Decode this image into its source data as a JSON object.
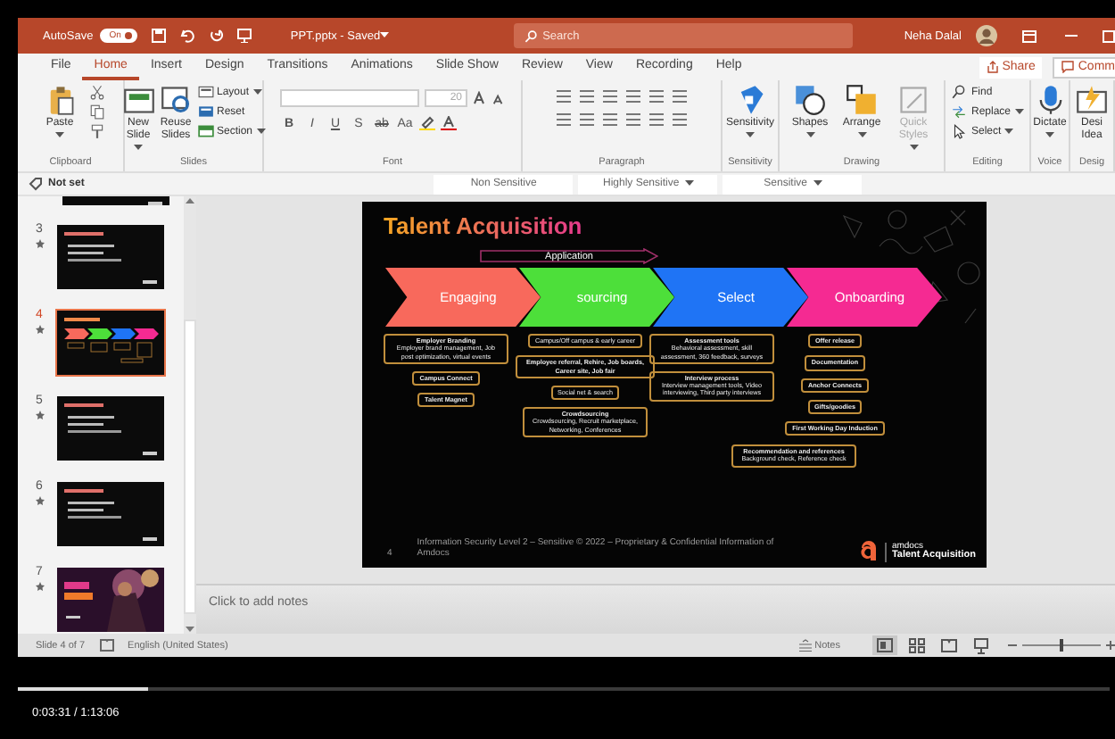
{
  "window": {
    "autosave_label": "AutoSave",
    "autosave_state": "On",
    "autosave_on": true,
    "title": "PPT.pptx - Saved",
    "search_placeholder": "Search",
    "user": "Neha Dalal"
  },
  "menu_tabs": [
    {
      "label": "File",
      "selected": false
    },
    {
      "label": "Home",
      "selected": true
    },
    {
      "label": "Insert",
      "selected": false
    },
    {
      "label": "Design",
      "selected": false
    },
    {
      "label": "Transitions",
      "selected": false
    },
    {
      "label": "Animations",
      "selected": false
    },
    {
      "label": "Slide Show",
      "selected": false
    },
    {
      "label": "Review",
      "selected": false
    },
    {
      "label": "View",
      "selected": false
    },
    {
      "label": "Recording",
      "selected": false
    },
    {
      "label": "Help",
      "selected": false
    }
  ],
  "share_button": "Share",
  "comments_button": "Comm",
  "ribbon": {
    "groups": [
      {
        "label": "Clipboard",
        "kind": "buttons",
        "items": [
          {
            "kind": "large",
            "label": "Paste",
            "dropdown": true
          },
          {
            "kind": "icon"
          },
          {
            "kind": "icon"
          },
          {
            "kind": "icon"
          }
        ]
      },
      {
        "label": "Slides",
        "kind": "buttons",
        "items": [
          {
            "kind": "large",
            "label": "New Slide",
            "dropdown": true
          },
          {
            "kind": "large",
            "label": "Reuse Slides",
            "dropdown": false
          },
          {
            "kind": "small",
            "label": "Layout",
            "dropdown": true
          },
          {
            "kind": "small",
            "label": "Reset",
            "dropdown": false
          },
          {
            "kind": "small",
            "label": "Section",
            "dropdown": true
          }
        ]
      },
      {
        "label": "Font",
        "kind": "font",
        "size": "20",
        "glyphs": [
          {
            "text": "B",
            "kind": "bold"
          },
          {
            "text": "I",
            "kind": "italic"
          },
          {
            "text": "U",
            "kind": "underline"
          },
          {
            "text": "S",
            "kind": "plain"
          },
          {
            "text": "ab",
            "kind": "strike"
          },
          {
            "text": "Aa",
            "kind": "plain"
          }
        ]
      },
      {
        "label": "Paragraph",
        "kind": "paragraph"
      },
      {
        "label": "Sensitivity",
        "kind": "buttons",
        "items": [
          {
            "kind": "large",
            "label": "Sensitivity",
            "dropdown": true
          }
        ]
      },
      {
        "label": "Drawing",
        "kind": "buttons",
        "items": [
          {
            "kind": "large",
            "label": "Shapes",
            "dropdown": true,
            "disabled": false
          },
          {
            "kind": "large",
            "label": "Arrange",
            "dropdown": true,
            "disabled": false
          },
          {
            "kind": "large",
            "label": "Quick Styles",
            "dropdown": true,
            "disabled": true
          }
        ]
      },
      {
        "label": "Editing",
        "kind": "buttons",
        "items": [
          {
            "kind": "small",
            "label": "Find",
            "dropdown": false
          },
          {
            "kind": "small",
            "label": "Replace",
            "dropdown": true
          },
          {
            "kind": "small",
            "label": "Select",
            "dropdown": true
          }
        ]
      },
      {
        "label": "Voice",
        "kind": "buttons",
        "items": [
          {
            "kind": "large",
            "label": "Dictate",
            "dropdown": true
          }
        ]
      },
      {
        "label": "Desig",
        "kind": "buttons",
        "items": [
          {
            "kind": "large",
            "label": "Desi Idea",
            "dropdown": false
          }
        ]
      }
    ]
  },
  "sensitivity_bar": {
    "status": "Not set",
    "labels": [
      {
        "label": "Non Sensitive",
        "dropdown": false
      },
      {
        "label": "Highly Sensitive",
        "dropdown": true
      },
      {
        "label": "Sensitive",
        "dropdown": true
      }
    ]
  },
  "slides_panel": {
    "slides": [
      {
        "number": "3",
        "selected": false,
        "kind": "text"
      },
      {
        "number": "4",
        "selected": true,
        "kind": "process"
      },
      {
        "number": "5",
        "selected": false,
        "kind": "text"
      },
      {
        "number": "6",
        "selected": false,
        "kind": "text"
      },
      {
        "number": "7",
        "selected": false,
        "kind": "photo"
      }
    ]
  },
  "slide": {
    "title": "Talent Acquisition",
    "flow_arrow": "Application",
    "stages": [
      {
        "label": "Engaging",
        "color": "#f8695c",
        "boxes": [
          {
            "title": "Employer Branding",
            "text": "Employer brand management, Job post optimization, virtual events"
          },
          {
            "title": "Campus Connect"
          },
          {
            "title": "Talent Magnet"
          }
        ]
      },
      {
        "label": "sourcing",
        "color": "#4ddf3a",
        "boxes": [
          {
            "text": "Campus/Off campus & early career"
          },
          {
            "title": "Employee referral, Rehire, Job boards, Career site, Job fair"
          },
          {
            "text": "Social net & search"
          },
          {
            "title": "Crowdsourcing",
            "text": "Crowdsourcing, Recruit marketplace, Networking, Conferences"
          }
        ]
      },
      {
        "label": "Select",
        "color": "#1f74f5",
        "boxes": [
          {
            "title": "Assessment tools",
            "text": "Behavioral assessment, skill assessment, 360 feedback, surveys"
          },
          {
            "title": "Interview process",
            "text": "Interview management tools, Video interviewing, Third party interviews"
          }
        ]
      },
      {
        "label": "Onboarding",
        "color": "#f52a92",
        "boxes": [
          {
            "title": "Offer release"
          },
          {
            "title": "Documentation"
          },
          {
            "title": "Anchor Connects"
          },
          {
            "title": "Gifts/goodies"
          },
          {
            "title": "First Working Day Induction"
          }
        ]
      }
    ],
    "extra_box": {
      "title": "Recommendation and references",
      "text": "Background check, Reference check"
    },
    "page_number": "4",
    "footer": "Information Security Level 2 – Sensitive © 2022 – Proprietary & Confidential Information of Amdocs",
    "logo_brand": "amdocs",
    "logo_caption": "Talent Acquisition"
  },
  "notes_prompt": "Click to add notes",
  "status_bar": {
    "slide_position": "Slide 4 of 7",
    "language": "English (United States)",
    "notes_button": "Notes",
    "views": [
      {
        "kind": "normal",
        "selected": true
      },
      {
        "kind": "sorter",
        "selected": false
      },
      {
        "kind": "reading",
        "selected": false
      },
      {
        "kind": "slideshow",
        "selected": false
      }
    ],
    "zoom": {
      "level": 0.5
    }
  },
  "video": {
    "progress": {
      "level": 0.12
    },
    "time": "0:03:31 / 1:13:06"
  }
}
